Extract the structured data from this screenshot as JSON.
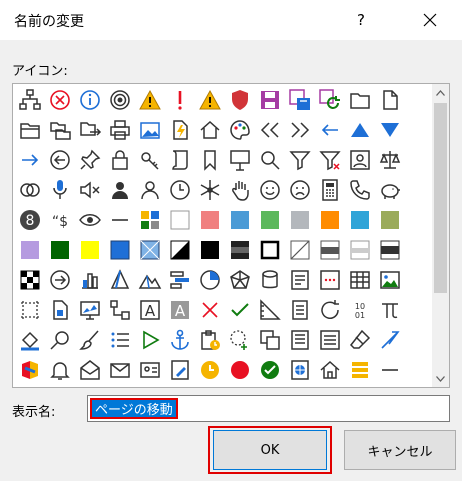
{
  "dialog": {
    "title": "名前の変更",
    "help_label": "?",
    "icon_list_label": "アイコン:",
    "name_label": "表示名:",
    "name_value": "ページの移動",
    "ok_label": "OK",
    "cancel_label": "キャンセル"
  },
  "colors": {
    "accent": "#0078d7",
    "highlight_border": "#e00000",
    "swatches": [
      "#f08080",
      "#4c9bd6",
      "#5cb85c",
      "#b3b7bc",
      "#ff8c00",
      "#2fa4d8",
      "#9bab5a",
      "#b59be0",
      "#006400",
      "#ffff00",
      "#1f6fd6"
    ]
  },
  "icons": [
    [
      "hierarchy-icon",
      "error-circle-icon",
      "info-circle-icon",
      "target-icon",
      "warning-icon",
      "exclamation-icon",
      "warning-icon",
      "shield-icon",
      "save-icon",
      "save-as-icon",
      "save-refresh-icon",
      "folder-icon",
      "document-icon"
    ],
    [
      "folder-open-icon",
      "copy-folder-icon",
      "move-folder-icon",
      "print-icon",
      "picture-icon",
      "flash-document-icon",
      "home-icon",
      "palette-icon",
      "double-left-arrow-icon",
      "double-right-arrow-icon",
      "left-arrow-icon",
      "up-triangle-icon",
      "down-triangle-icon"
    ],
    [
      "right-arrow-icon",
      "circle-left-arrow-icon",
      "pin-icon",
      "lock-icon",
      "key-icon",
      "scroll-icon",
      "bookmark-icon",
      "easel-icon",
      "magnifier-icon",
      "filter-icon",
      "filter-clear-icon",
      "user-card-icon",
      "scales-icon"
    ],
    [
      "venn-icon",
      "microphone-icon",
      "speaker-mute-icon",
      "person-icon",
      "person-outline-icon",
      "clock-icon",
      "snowflake-icon",
      "hand-icon",
      "smile-icon",
      "frown-icon",
      "calculator-icon",
      "phone-icon",
      "piggy-bank-icon"
    ],
    [
      "number-eight-icon",
      "quote-dollar-icon",
      "eye-icon",
      "dash-icon",
      "color-grid-icon",
      "swatch-white",
      "swatch-salmon",
      "swatch-blue",
      "swatch-green",
      "swatch-gray",
      "swatch-orange",
      "swatch-sky",
      "swatch-olive"
    ],
    [
      "swatch-lavender",
      "swatch-dark-green",
      "swatch-yellow",
      "swatch-mid-blue",
      "swatch-hatched",
      "swatch-diagonal",
      "swatch-black",
      "swatch-gradient-dark",
      "swatch-border-black",
      "swatch-slash",
      "swatch-gray-band",
      "swatch-light-band",
      "swatch-dark-band"
    ],
    [
      "checker-icon",
      "circle-right-arrow-icon",
      "bar-chart-icon",
      "pyramid-icon",
      "mountain-icon",
      "gantt-icon",
      "pie-chart-icon",
      "radar-chart-icon",
      "database-icon",
      "form-icon",
      "dots-form-icon",
      "table-icon",
      "landscape-icon"
    ],
    [
      "select-icon",
      "select-doc-icon",
      "screen-chart-icon",
      "diagram-icon",
      "text-a-icon",
      "text-a-shaded-icon",
      "cross-icon",
      "check-icon",
      "ruler-icon",
      "list-doc-icon",
      "refresh-icon",
      "binary-icon",
      "pi-icon"
    ],
    [
      "fill-icon",
      "search-icon",
      "brush-icon",
      "bullet-list-icon",
      "play-icon",
      "anchor-icon",
      "clipboard-icon",
      "dashed-select-icon",
      "copy-icon",
      "form-doc-icon",
      "list-icon",
      "eraser-icon",
      "pen-icon"
    ],
    [
      "office-logo-icon",
      "bell-icon",
      "envelope-open-icon",
      "envelope-icon",
      "contact-card-icon",
      "edit-doc-icon",
      "clock-circle-icon",
      "red-circle-icon",
      "green-check-icon",
      "globe-doc-icon",
      "home-outline-icon",
      "stack-icon",
      "dash-icon"
    ]
  ]
}
